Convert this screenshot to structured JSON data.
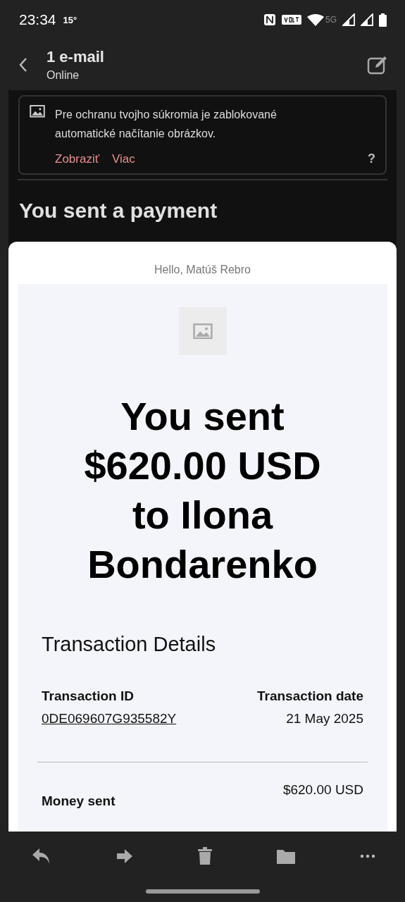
{
  "status_bar": {
    "time": "23:34",
    "temperature": "15°",
    "network": "5G"
  },
  "header": {
    "title": "1 e-mail",
    "subtitle": "Online"
  },
  "notice": {
    "text": "Pre ochranu tvojho súkromia je zablokované automatické načítanie obrázkov.",
    "actions": [
      "Zobraziť",
      "Viac"
    ],
    "help": "?"
  },
  "subject": "You sent a payment",
  "email": {
    "greeting": "Hello, Matúš Rebro",
    "headline": "You sent $620.00 USD to Ilona Bondarenko",
    "section_title": "Transaction Details",
    "details": [
      {
        "label": "Transaction ID",
        "value": "0DE069607G935582Y",
        "kind": "link"
      },
      {
        "label": "Transaction date",
        "value": "21 May 2025",
        "kind": "text"
      }
    ],
    "money_sent": {
      "label": "Money sent",
      "value": "$620.00 USD"
    }
  }
}
